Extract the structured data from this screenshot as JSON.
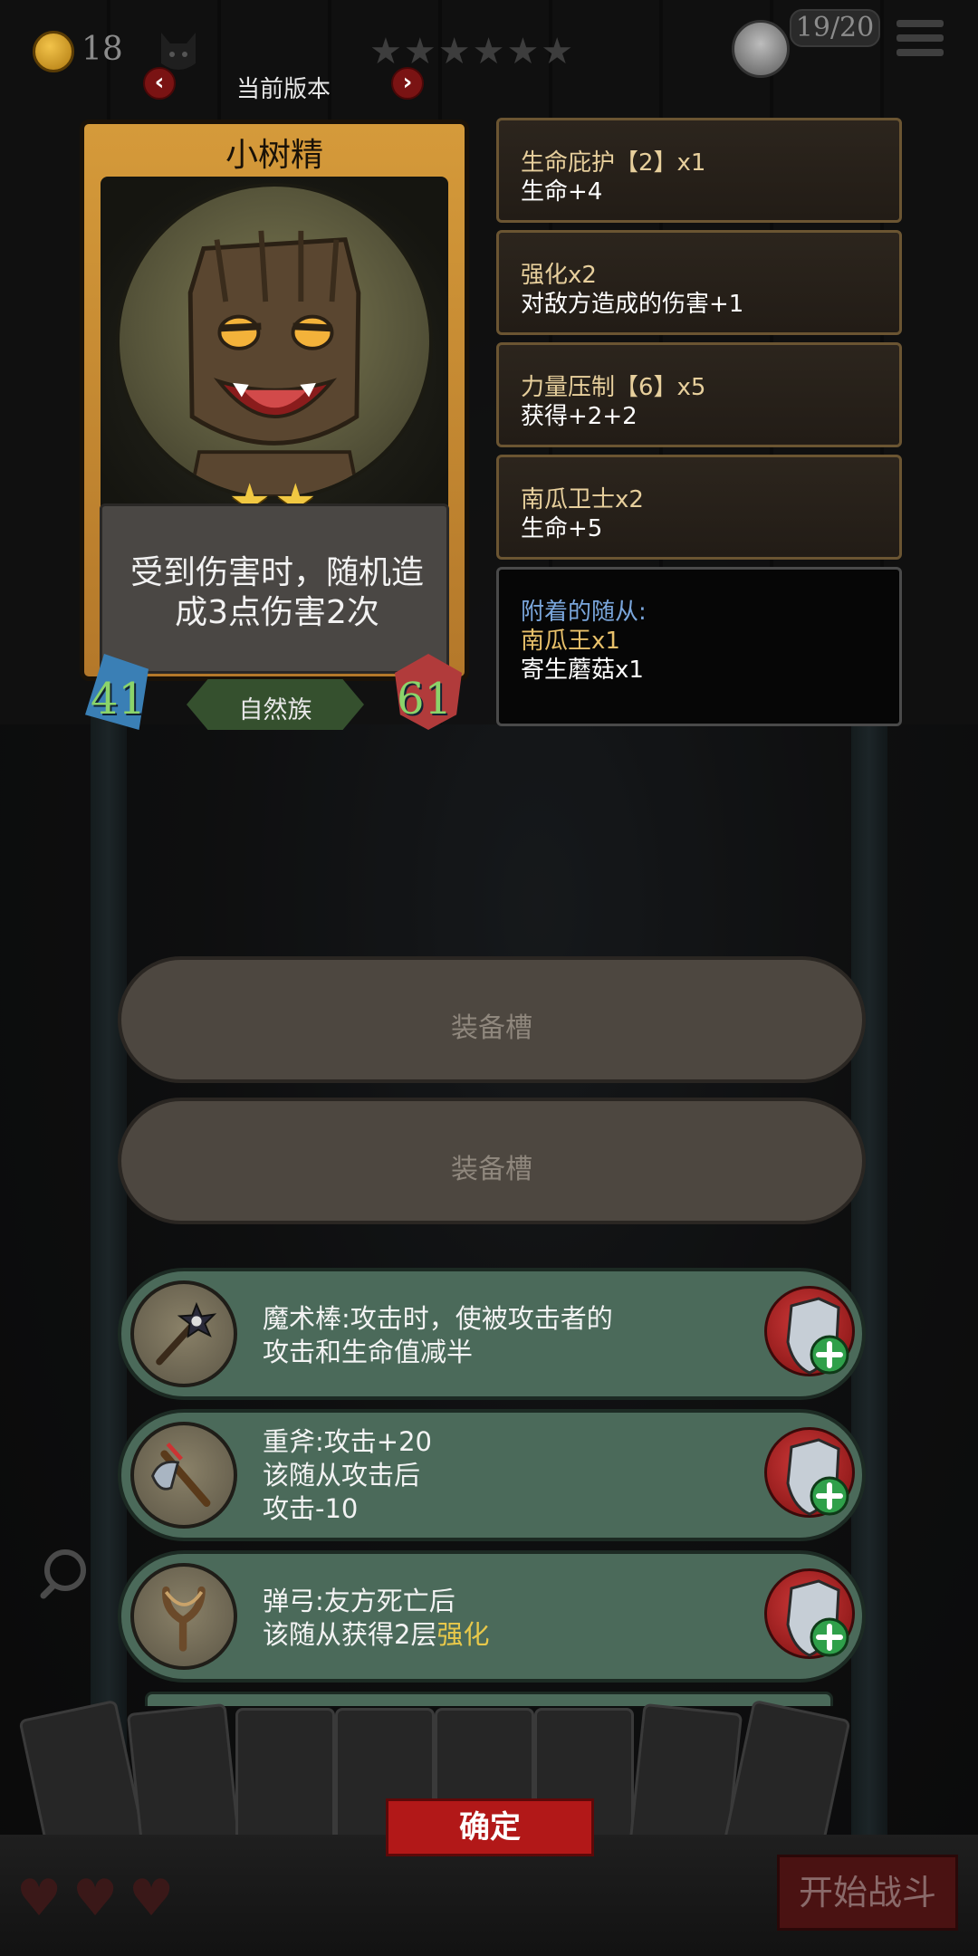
{
  "topbar": {
    "coin_count": "18",
    "stars": "★★★★★★",
    "turn_counter": "19/20"
  },
  "version": {
    "label": "当前版本",
    "prev": "‹",
    "next": "›"
  },
  "card": {
    "name": "小树精",
    "stars": "★★",
    "description": "受到伤害时，随机造成3点伤害2次",
    "tribe": "自然族",
    "attack": "41",
    "health": "61"
  },
  "buffs": [
    {
      "title": "生命庇护【2】x1",
      "effect": "生命+4"
    },
    {
      "title": "强化x2",
      "effect": "对敌方造成的伤害+1"
    },
    {
      "title": "力量压制【6】x5",
      "effect": "获得+2+2"
    },
    {
      "title": "南瓜卫士x2",
      "effect": "生命+5"
    }
  ],
  "attached": {
    "heading": "附着的随从:",
    "items": [
      "南瓜王x1",
      "寄生蘑菇x1"
    ]
  },
  "slots": [
    "装备槽",
    "装备槽"
  ],
  "equipment": [
    {
      "line1": "魔术棒:攻击时，使被攻击者的",
      "line2": "攻击和生命值减半",
      "line3": "",
      "icon": "magic-wand-icon"
    },
    {
      "line1": "重斧:攻击+20",
      "line2": "该随从攻击后",
      "line3": "攻击-10",
      "icon": "axe-icon"
    },
    {
      "line1": "弹弓:友方死亡后",
      "line2_prefix": "该随从获得2层",
      "line2_highlight": "强化",
      "icon": "slingshot-icon"
    }
  ],
  "buttons": {
    "confirm": "确定",
    "start_battle": "开始战斗"
  },
  "colors": {
    "card_gold": "#d59a3a",
    "equip_green": "#4b6a5a",
    "slot_brown": "#4d4740",
    "confirm_red": "#b21818",
    "highlight": "#e8c84a"
  }
}
